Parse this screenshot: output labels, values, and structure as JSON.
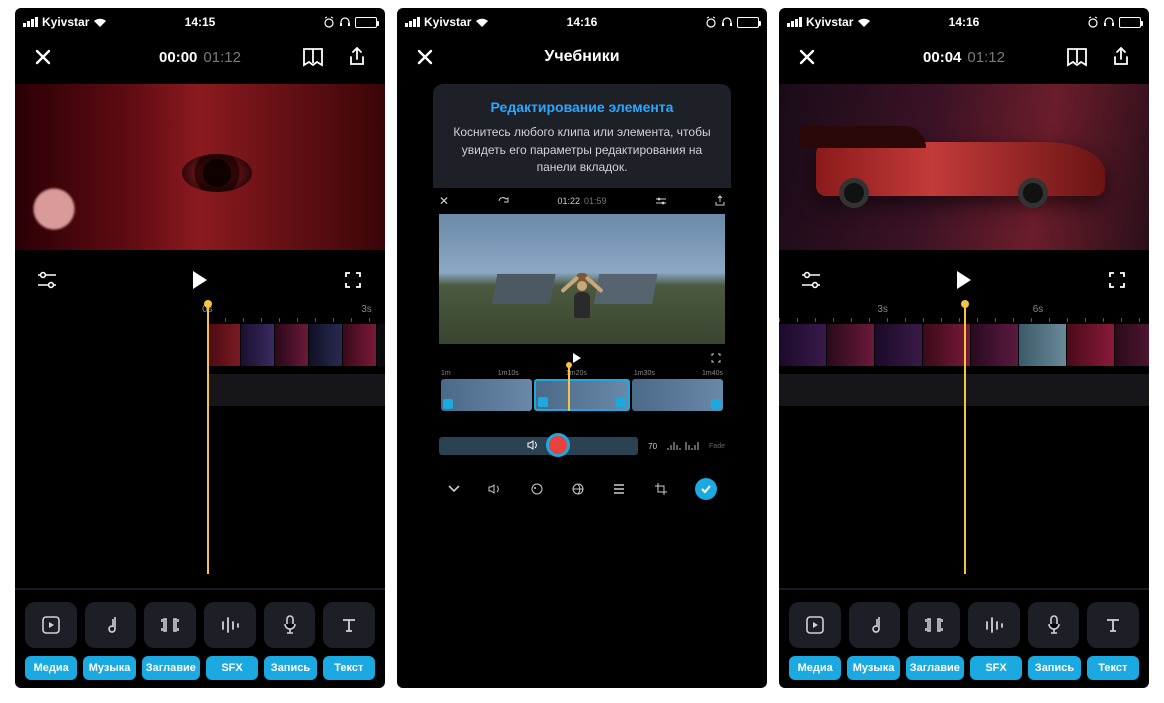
{
  "status": {
    "carrier": "Kyivstar",
    "times": [
      "14:15",
      "14:16",
      "14:16"
    ]
  },
  "screen1": {
    "current": "00:00",
    "total": "01:12",
    "ruler": [
      "0s",
      "3s"
    ],
    "tools": [
      "Медиа",
      "Музыка",
      "Заглавие",
      "SFX",
      "Запись",
      "Текст"
    ]
  },
  "screen2": {
    "header": "Учебники",
    "card_title": "Редактирование элемента",
    "card_desc": "Коснитесь любого клипа или элемента, чтобы увидеть его параметры редактирования на панели вкладок.",
    "mini": {
      "current": "01:22",
      "total": "01:59",
      "ruler": [
        "1m",
        "1m10s",
        "1m20s",
        "1m30s",
        "1m40s"
      ],
      "slider_value": "70",
      "fade": "Fade"
    }
  },
  "screen3": {
    "current": "00:04",
    "total": "01:12",
    "ruler": [
      "3s",
      "6s"
    ],
    "tools": [
      "Медиа",
      "Музыка",
      "Заглавие",
      "SFX",
      "Запись",
      "Текст"
    ]
  }
}
